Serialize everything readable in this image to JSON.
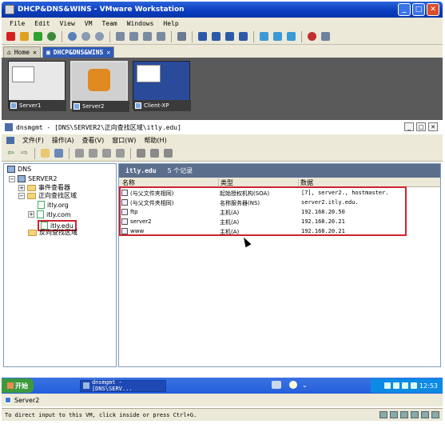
{
  "vmware": {
    "title": "DHCP&DNS&WINS - VMware Workstation",
    "menu": [
      "File",
      "Edit",
      "View",
      "VM",
      "Team",
      "Windows",
      "Help"
    ],
    "tabs": [
      {
        "label": "Home",
        "active": false
      },
      {
        "label": "DHCP&DNS&WINS",
        "active": true
      }
    ],
    "thumbnails": [
      {
        "label": "Server1"
      },
      {
        "label": "Server2"
      },
      {
        "label": "Client-XP"
      }
    ],
    "vm_name": "Server2",
    "status_text": "To direct input to this VM, click inside or press Ctrl+G."
  },
  "mmc": {
    "title": "dnsmgmt - [DNS\\SERVER2\\正向查找区域\\itly.edu]",
    "menu": [
      "文件(F)",
      "操作(A)",
      "查看(V)",
      "窗口(W)",
      "帮助(H)"
    ],
    "tree": {
      "root": "DNS",
      "server": "SERVER2",
      "event_viewer": "事件查看器",
      "forward_zones": "正向查找区域",
      "zones": [
        "itly.org",
        "itly.com",
        "itly.edu"
      ],
      "reverse_zones": "反向查找区域",
      "selected_zone": "itly.edu"
    },
    "details": {
      "zone_name": "itly.edu",
      "record_count": "5 个记录",
      "columns": [
        "名称",
        "类型",
        "数据"
      ],
      "records": [
        {
          "name": "(与父文件夹相同)",
          "type": "起始授权机构(SOA)",
          "data": "[7], server2., hostmaster."
        },
        {
          "name": "(与父文件夹相同)",
          "type": "名称服务器(NS)",
          "data": "server2.itly.edu."
        },
        {
          "name": "ftp",
          "type": "主机(A)",
          "data": "192.168.20.50"
        },
        {
          "name": "server2",
          "type": "主机(A)",
          "data": "192.168.20.21"
        },
        {
          "name": "www",
          "type": "主机(A)",
          "data": "192.168.20.21"
        }
      ]
    }
  },
  "taskbar": {
    "start_label": "开始",
    "task_label": "dnsmgmt - [DNS\\SERV...",
    "clock": "12:53"
  }
}
